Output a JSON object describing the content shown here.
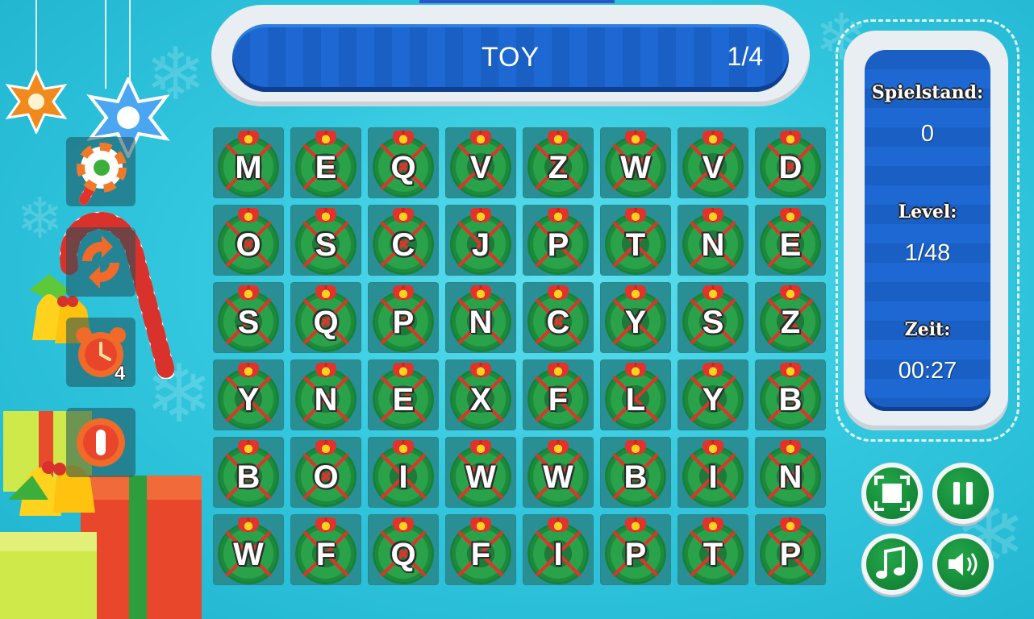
{
  "game": {
    "target_word": "TOY",
    "word_progress": "1/4"
  },
  "grid": {
    "rows": [
      [
        "M",
        "E",
        "Q",
        "V",
        "Z",
        "W",
        "V",
        "D"
      ],
      [
        "O",
        "S",
        "C",
        "J",
        "P",
        "T",
        "N",
        "E"
      ],
      [
        "S",
        "Q",
        "P",
        "N",
        "C",
        "Y",
        "S",
        "Z"
      ],
      [
        "Y",
        "N",
        "E",
        "X",
        "F",
        "L",
        "Y",
        "B"
      ],
      [
        "B",
        "O",
        "I",
        "W",
        "W",
        "B",
        "I",
        "N"
      ],
      [
        "W",
        "F",
        "Q",
        "F",
        "I",
        "P",
        "T",
        "P"
      ]
    ]
  },
  "stats": {
    "score_label": "Spielstand:",
    "score_value": "0",
    "level_label": "Level:",
    "level_value": "1/48",
    "time_label": "Zeit:",
    "time_value": "00:27"
  },
  "powerups": {
    "hint_count": "4",
    "icons": [
      "candy-icon",
      "shuffle-icon",
      "alarm-clock-icon",
      "stop-icon"
    ]
  },
  "controls": {
    "icons": [
      "fullscreen-icon",
      "pause-icon",
      "music-icon",
      "sound-icon"
    ]
  },
  "colors": {
    "panel_blue": "#1a5fc4",
    "button_green": "#0e7a2f",
    "tile_teal": "#2a8f95",
    "background": "#33c8df"
  }
}
